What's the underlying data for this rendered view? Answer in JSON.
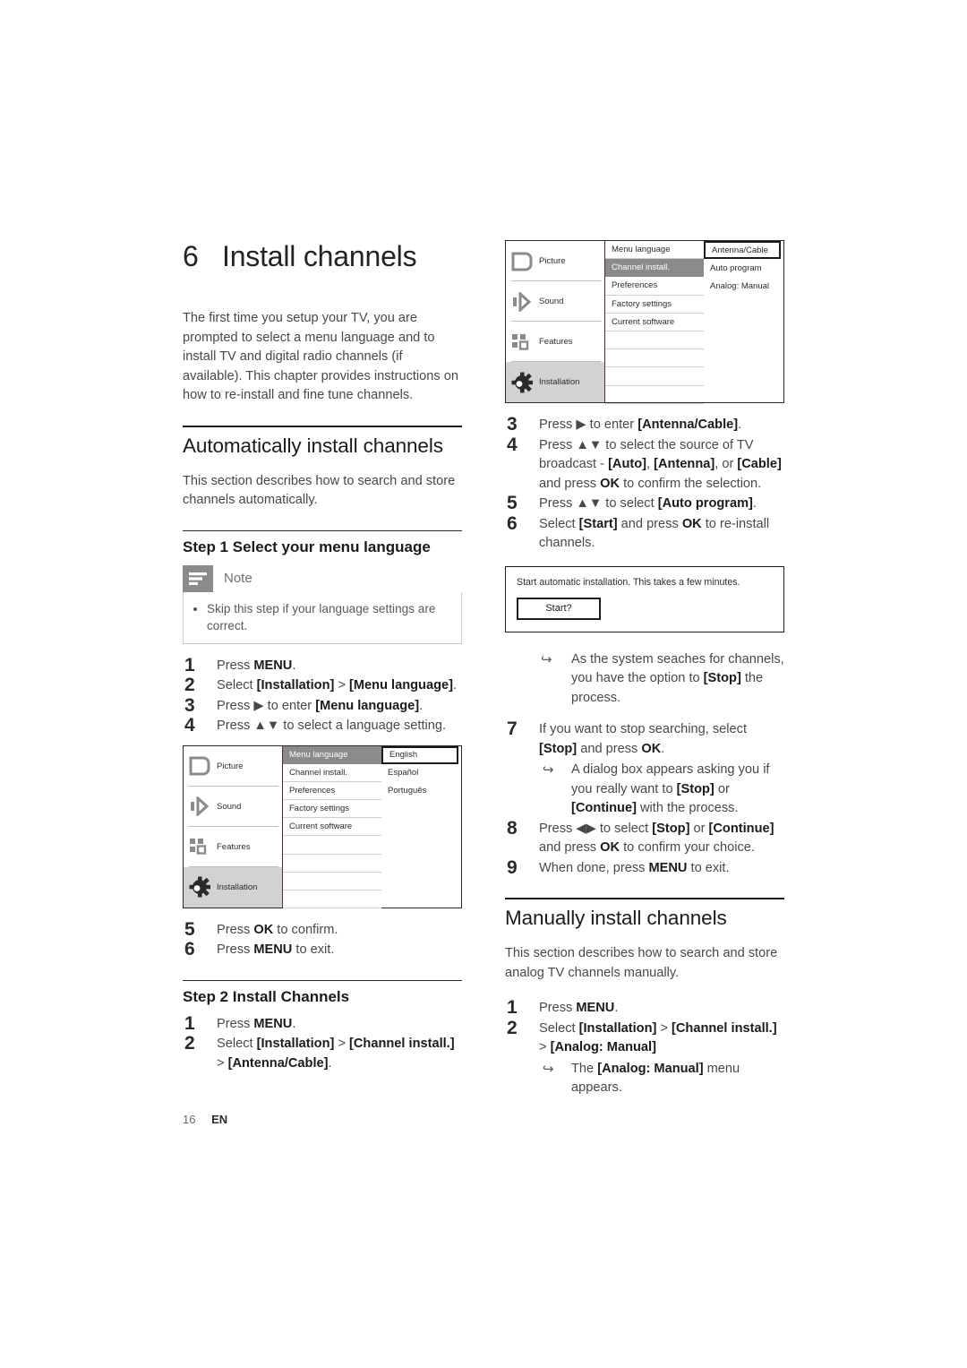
{
  "chapter": {
    "number": "6",
    "title": "Install channels",
    "intro": "The first time you setup your TV, you are prompted to select a menu language and to install TV and digital radio channels (if available). This chapter provides instructions on how to re-install and fine tune channels."
  },
  "auto_section": {
    "heading": "Automatically install channels",
    "intro": "This section describes how to search and store channels automatically.",
    "step1": {
      "heading": "Step 1 Select your menu language",
      "note": {
        "label": "Note",
        "icon": "note-lines-icon",
        "text": "Skip this step if your language settings are correct."
      },
      "steps": [
        {
          "num": "1",
          "parts": [
            {
              "t": "Press ",
              "b": false
            },
            {
              "t": "MENU",
              "b": true
            },
            {
              "t": ".",
              "b": false
            }
          ]
        },
        {
          "num": "2",
          "parts": [
            {
              "t": "Select ",
              "b": false
            },
            {
              "t": "[Installation]",
              "b": true
            },
            {
              "t": " > ",
              "b": false
            },
            {
              "t": "[Menu language]",
              "b": true
            },
            {
              "t": ".",
              "b": false
            }
          ]
        },
        {
          "num": "3",
          "parts": [
            {
              "t": "Press ",
              "b": false
            },
            {
              "t": "▶",
              "b": false
            },
            {
              "t": " to enter ",
              "b": false
            },
            {
              "t": "[Menu language]",
              "b": true
            },
            {
              "t": ".",
              "b": false
            }
          ]
        },
        {
          "num": "4",
          "parts": [
            {
              "t": "Press ",
              "b": false
            },
            {
              "t": "▲▼",
              "b": false
            },
            {
              "t": " to select a language setting.",
              "b": false
            }
          ]
        }
      ],
      "steps_after": [
        {
          "num": "5",
          "parts": [
            {
              "t": "Press ",
              "b": false
            },
            {
              "t": "OK",
              "b": true
            },
            {
              "t": " to confirm.",
              "b": false
            }
          ]
        },
        {
          "num": "6",
          "parts": [
            {
              "t": "Press ",
              "b": false
            },
            {
              "t": "MENU",
              "b": true
            },
            {
              "t": " to exit.",
              "b": false
            }
          ]
        }
      ]
    },
    "step2": {
      "heading": "Step 2 Install Channels",
      "steps": [
        {
          "num": "1",
          "parts": [
            {
              "t": "Press ",
              "b": false
            },
            {
              "t": "MENU",
              "b": true
            },
            {
              "t": ".",
              "b": false
            }
          ]
        },
        {
          "num": "2",
          "parts": [
            {
              "t": "Select ",
              "b": false
            },
            {
              "t": "[Installation]",
              "b": true
            },
            {
              "t": " > ",
              "b": false
            },
            {
              "t": "[Channel install.]",
              "b": true
            },
            {
              "t": " > ",
              "b": false
            },
            {
              "t": "[Antenna/Cable]",
              "b": true
            },
            {
              "t": ".",
              "b": false
            }
          ]
        }
      ],
      "steps_right": [
        {
          "num": "3",
          "parts": [
            {
              "t": "Press ",
              "b": false
            },
            {
              "t": "▶",
              "b": false
            },
            {
              "t": " to enter ",
              "b": false
            },
            {
              "t": "[Antenna/Cable]",
              "b": true
            },
            {
              "t": ".",
              "b": false
            }
          ]
        },
        {
          "num": "4",
          "parts": [
            {
              "t": "Press ",
              "b": false
            },
            {
              "t": "▲▼",
              "b": false
            },
            {
              "t": " to select the source of TV broadcast - ",
              "b": false
            },
            {
              "t": "[Auto]",
              "b": true
            },
            {
              "t": ", ",
              "b": false
            },
            {
              "t": "[Antenna]",
              "b": true
            },
            {
              "t": ", or ",
              "b": false
            },
            {
              "t": "[Cable]",
              "b": true
            },
            {
              "t": " and press ",
              "b": false
            },
            {
              "t": "OK",
              "b": true
            },
            {
              "t": " to confirm the selection.",
              "b": false
            }
          ]
        },
        {
          "num": "5",
          "parts": [
            {
              "t": "Press ",
              "b": false
            },
            {
              "t": "▲▼",
              "b": false
            },
            {
              "t": " to select ",
              "b": false
            },
            {
              "t": "[Auto program]",
              "b": true
            },
            {
              "t": ".",
              "b": false
            }
          ]
        },
        {
          "num": "6",
          "parts": [
            {
              "t": "Select ",
              "b": false
            },
            {
              "t": "[Start]",
              "b": true
            },
            {
              "t": " and press ",
              "b": false
            },
            {
              "t": "OK",
              "b": true
            },
            {
              "t": " to re-install channels.",
              "b": false
            }
          ]
        }
      ],
      "arrow_after_dialog": [
        {
          "t": "As the system seaches for channels, you have the option to ",
          "b": false
        },
        {
          "t": "[Stop]",
          "b": true
        },
        {
          "t": " the process.",
          "b": false
        }
      ],
      "steps_tail": [
        {
          "num": "7",
          "parts": [
            {
              "t": "If you want to stop searching, select ",
              "b": false
            },
            {
              "t": "[Stop]",
              "b": true
            },
            {
              "t": " and press ",
              "b": false
            },
            {
              "t": "OK",
              "b": true
            },
            {
              "t": ".",
              "b": false
            }
          ],
          "arrow": [
            {
              "t": "A dialog box appears asking you if you really want to ",
              "b": false
            },
            {
              "t": "[Stop]",
              "b": true
            },
            {
              "t": " or ",
              "b": false
            },
            {
              "t": "[Continue]",
              "b": true
            },
            {
              "t": " with the process.",
              "b": false
            }
          ]
        },
        {
          "num": "8",
          "parts": [
            {
              "t": "Press ",
              "b": false
            },
            {
              "t": "◀▶",
              "b": false
            },
            {
              "t": " to select ",
              "b": false
            },
            {
              "t": "[Stop]",
              "b": true
            },
            {
              "t": " or ",
              "b": false
            },
            {
              "t": "[Continue]",
              "b": true
            },
            {
              "t": " and press ",
              "b": false
            },
            {
              "t": "OK",
              "b": true
            },
            {
              "t": " to confirm your choice.",
              "b": false
            }
          ]
        },
        {
          "num": "9",
          "parts": [
            {
              "t": "When done, press ",
              "b": false
            },
            {
              "t": "MENU",
              "b": true
            },
            {
              "t": " to exit.",
              "b": false
            }
          ]
        }
      ]
    }
  },
  "manual_section": {
    "heading": "Manually install channels",
    "intro": "This section describes how to search and store analog TV channels manually.",
    "steps": [
      {
        "num": "1",
        "parts": [
          {
            "t": "Press ",
            "b": false
          },
          {
            "t": "MENU",
            "b": true
          },
          {
            "t": ".",
            "b": false
          }
        ]
      },
      {
        "num": "2",
        "parts": [
          {
            "t": "Select ",
            "b": false
          },
          {
            "t": "[Installation]",
            "b": true
          },
          {
            "t": " > ",
            "b": false
          },
          {
            "t": "[Channel install.]",
            "b": true
          },
          {
            "t": " > ",
            "b": false
          },
          {
            "t": "[Analog: Manual]",
            "b": true
          }
        ],
        "arrow": [
          {
            "t": "The ",
            "b": false
          },
          {
            "t": "[Analog: Manual]",
            "b": true
          },
          {
            "t": " menu appears.",
            "b": false
          }
        ]
      }
    ]
  },
  "tv_menu_language": {
    "left_items": [
      {
        "label": "Picture",
        "icon": "picture-icon",
        "selected": false
      },
      {
        "label": "Sound",
        "icon": "sound-icon",
        "selected": false
      },
      {
        "label": "Features",
        "icon": "features-icon",
        "selected": false
      },
      {
        "label": "Installation",
        "icon": "installation-gear-icon",
        "selected": true
      }
    ],
    "middle_items": [
      {
        "label": "Menu language",
        "highlighted": true
      },
      {
        "label": "Channel install.",
        "highlighted": false
      },
      {
        "label": "Preferences",
        "highlighted": false
      },
      {
        "label": "Factory settings",
        "highlighted": false
      },
      {
        "label": "Current software",
        "highlighted": false
      },
      {
        "label": "",
        "highlighted": false
      },
      {
        "label": "",
        "highlighted": false
      },
      {
        "label": "",
        "highlighted": false
      },
      {
        "label": "",
        "highlighted": false
      }
    ],
    "right_items": [
      {
        "label": "English",
        "boxed": true
      },
      {
        "label": "Español",
        "boxed": false
      },
      {
        "label": "Português",
        "boxed": false
      }
    ]
  },
  "tv_menu_channel": {
    "left_items": [
      {
        "label": "Picture",
        "icon": "picture-icon",
        "selected": false
      },
      {
        "label": "Sound",
        "icon": "sound-icon",
        "selected": false
      },
      {
        "label": "Features",
        "icon": "features-icon",
        "selected": false
      },
      {
        "label": "Installation",
        "icon": "installation-gear-icon",
        "selected": true
      }
    ],
    "middle_items": [
      {
        "label": "Menu language",
        "highlighted": false
      },
      {
        "label": "Channel install.",
        "highlighted": true
      },
      {
        "label": "Preferences",
        "highlighted": false
      },
      {
        "label": "Factory settings",
        "highlighted": false
      },
      {
        "label": "Current software",
        "highlighted": false
      },
      {
        "label": "",
        "highlighted": false
      },
      {
        "label": "",
        "highlighted": false
      },
      {
        "label": "",
        "highlighted": false
      },
      {
        "label": "",
        "highlighted": false
      }
    ],
    "right_items": [
      {
        "label": "Antenna/Cable",
        "boxed": true
      },
      {
        "label": "Auto program",
        "boxed": false
      },
      {
        "label": "Analog: Manual",
        "boxed": false
      }
    ]
  },
  "start_dialog": {
    "message": "Start automatic installation. This takes a few minutes.",
    "button": "Start?"
  },
  "footer": {
    "page": "16",
    "lang": "EN"
  },
  "colors": {
    "highlight_row": "#8b8b8b",
    "selected_sidebar": "#d2d2d2",
    "icon_gray": "#8b8b8b",
    "rule_dark": "#1b1b1b"
  }
}
